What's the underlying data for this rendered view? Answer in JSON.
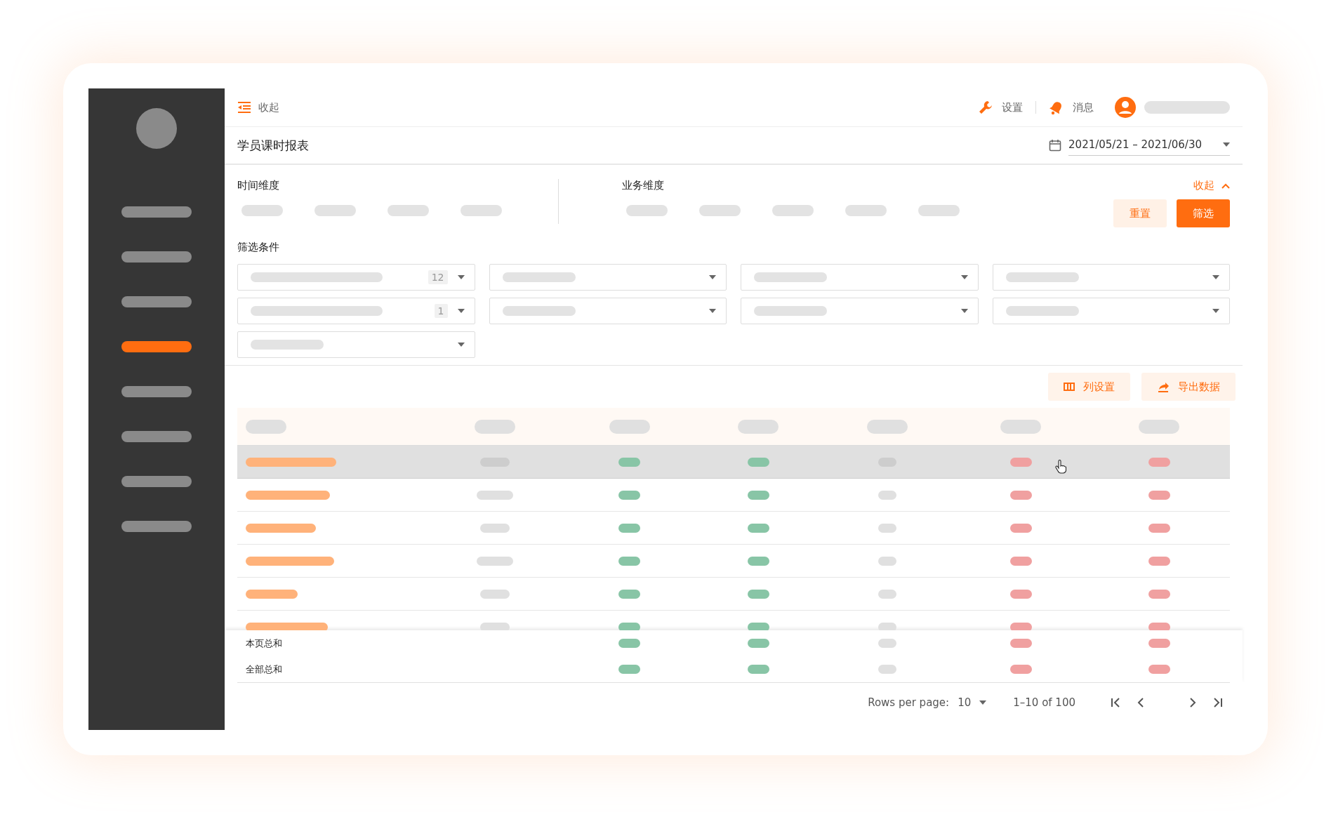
{
  "sidebar": {
    "items": [
      {
        "selected": false
      },
      {
        "selected": false
      },
      {
        "selected": false
      },
      {
        "selected": true
      },
      {
        "selected": false
      },
      {
        "selected": false
      },
      {
        "selected": false
      },
      {
        "selected": false
      }
    ]
  },
  "topbar": {
    "collapse_label": "收起",
    "settings_label": "设置",
    "messages_label": "消息"
  },
  "page": {
    "title": "学员课时报表",
    "date_range": "2021/05/21 – 2021/06/30"
  },
  "dimensions": {
    "time_label": "时间维度",
    "business_label": "业务维度",
    "collapse_link": "收起",
    "reset_button": "重置",
    "filter_button": "筛选"
  },
  "filters": {
    "label": "筛选条件",
    "counts": [
      "12",
      "1"
    ]
  },
  "toolbar": {
    "buttons": [
      "列设置",
      "导出数据"
    ]
  },
  "table": {
    "rows": [
      {
        "hovered": true
      },
      {
        "hovered": false
      },
      {
        "hovered": false
      },
      {
        "hovered": false
      },
      {
        "hovered": false
      },
      {
        "hovered": false
      }
    ],
    "summary_rows": [
      {
        "label": "本页总和"
      },
      {
        "label": "全部总和"
      }
    ]
  },
  "pagination": {
    "rows_per_page_label": "Rows per page:",
    "rows_per_page": "10",
    "range": "1–10 of 100"
  }
}
